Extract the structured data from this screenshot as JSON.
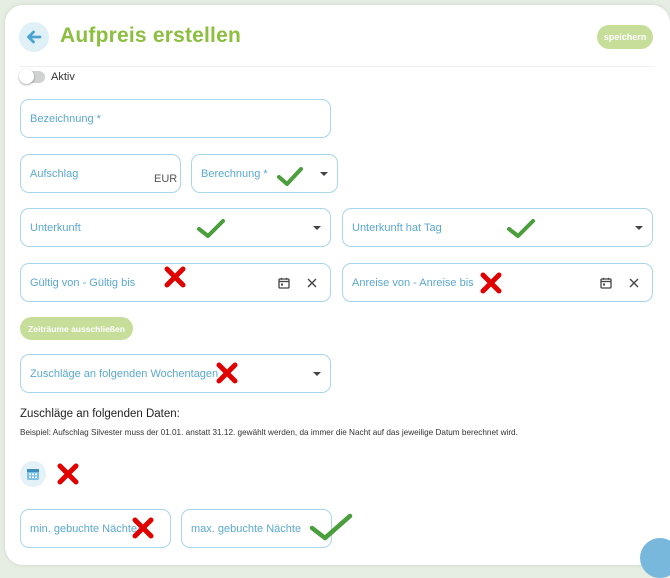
{
  "header": {
    "title": "Aufpreis erstellen",
    "save_label": "speichern"
  },
  "toggle": {
    "label": "Aktiv",
    "on": false
  },
  "fields": {
    "bezeichnung": {
      "label": "Bezeichnung",
      "required": "*"
    },
    "aufschlag": {
      "label": "Aufschlag",
      "unit": "EUR"
    },
    "berechnung": {
      "label": "Berechnung",
      "required": "*"
    },
    "unterkunft": {
      "label": "Unterkunft"
    },
    "unterkunft_tag": {
      "label": "Unterkunft hat Tag"
    },
    "gueltig": {
      "label": "Gültig von - Gültig bis"
    },
    "anreise": {
      "label": "Anreise von - Anreise bis"
    },
    "wochentage": {
      "label": "Zuschläge an folgenden Wochentagen"
    },
    "min_naechte": {
      "label": "min. gebuchte Nächte"
    },
    "max_naechte": {
      "label": "max. gebuchte Nächte"
    }
  },
  "zeitraeume_button": "Zeiträume ausschließen",
  "dates_section": {
    "title": "Zuschläge an folgenden Daten:",
    "hint": "Beispiel: Aufschlag Silvester muss der 01.01. anstatt 31.12. gewählt werden, da immer die Nacht auf das jeweilige Datum berechnet wird."
  },
  "colors": {
    "accent_green": "#8cbf3f",
    "field_border": "#a8d6ea",
    "label_blue": "#5ba9cf",
    "check_green": "#4a9e3b",
    "cross_red": "#e10000"
  },
  "icons": [
    "arrow-left-icon",
    "calendar-icon",
    "close-icon",
    "chevron-down-icon",
    "checkmark-icon",
    "cross-icon"
  ]
}
